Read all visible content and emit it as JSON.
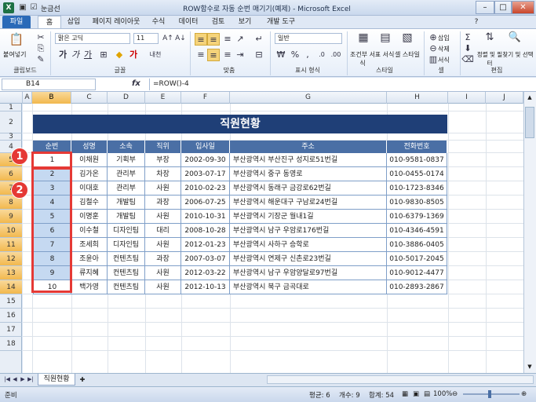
{
  "window": {
    "title": "ROW함수로 자동 순번 매기기(예제) - Microsoft Excel",
    "quick_access_label": "눈금선",
    "app_letter": "X",
    "controls": {
      "minimize": "–",
      "maximize": "□",
      "close": "✕"
    }
  },
  "tabs": [
    "파일",
    "홈",
    "삽입",
    "페이지 레이아웃",
    "수식",
    "데이터",
    "검토",
    "보기",
    "개발 도구"
  ],
  "ribbon": {
    "paste_label": "붙여넣기",
    "font_name": "맑은 고딕",
    "font_size": "11",
    "bold": "가",
    "italic": "가",
    "underline": "가",
    "number_format": "일반",
    "conditional": "조건부 서식",
    "table": "표 서식",
    "cell_style": "셀 스타일",
    "insert": "삽입",
    "delete": "삭제",
    "format": "서식",
    "sort_filter": "정렬 및 필터",
    "find_select": "찾기 및 선택",
    "groups": [
      "클립보드",
      "글꼴",
      "맞춤",
      "표시 형식",
      "스타일",
      "셀",
      "편집"
    ]
  },
  "formula_bar": {
    "name_box": "B14",
    "fx": "fx",
    "formula": "=ROW()-4"
  },
  "columns": [
    "A",
    "B",
    "C",
    "D",
    "E",
    "F",
    "G",
    "H",
    "I",
    "J"
  ],
  "selected_column": "B",
  "rows": [
    "1",
    "2",
    "3",
    "4",
    "5",
    "6",
    "7",
    "8",
    "9",
    "10",
    "11",
    "12",
    "13",
    "14",
    "15",
    "16",
    "17",
    "18"
  ],
  "selected_rows": [
    "5",
    "6",
    "7",
    "8",
    "9",
    "10",
    "11",
    "12",
    "13",
    "14"
  ],
  "table": {
    "title": "직원현황",
    "headers": [
      "순번",
      "성명",
      "소속",
      "직위",
      "입사일",
      "주소",
      "전화번호"
    ],
    "rows": [
      [
        "1",
        "이채원",
        "기획부",
        "부장",
        "2002-09-30",
        "부산광역시 부산진구 성지로51번길",
        "010-9581-0837"
      ],
      [
        "2",
        "김가온",
        "관리부",
        "차장",
        "2003-07-17",
        "부산광역시 중구 동영로",
        "010-0455-0174"
      ],
      [
        "3",
        "이대호",
        "관리부",
        "사원",
        "2010-02-23",
        "부산광역시 동래구 금강로62번길",
        "010-1723-8346"
      ],
      [
        "4",
        "김철수",
        "개발팀",
        "과장",
        "2006-07-25",
        "부산광역시 해운대구 구남로24번길",
        "010-9830-8505"
      ],
      [
        "5",
        "이명훈",
        "개발팀",
        "사원",
        "2010-10-31",
        "부산광역시 기장군 월내1길",
        "010-6379-1369"
      ],
      [
        "6",
        "이수철",
        "디자인팀",
        "대리",
        "2008-10-28",
        "부산광역시 남구 우암로176번길",
        "010-4346-4591"
      ],
      [
        "7",
        "조세희",
        "디자인팀",
        "사원",
        "2012-01-23",
        "부산광역시 사하구 승학로",
        "010-3886-0405"
      ],
      [
        "8",
        "조윤아",
        "컨텐츠팀",
        "과장",
        "2007-03-07",
        "부산광역시 연제구 신촌로23번길",
        "010-5017-2045"
      ],
      [
        "9",
        "류지혜",
        "컨텐츠팀",
        "사원",
        "2012-03-22",
        "부산광역시 남구 우암양달로97번길",
        "010-9012-4477"
      ],
      [
        "10",
        "백가영",
        "컨텐츠팀",
        "사원",
        "2012-10-13",
        "부산광역시 북구 금곡대로",
        "010-2893-2867"
      ]
    ]
  },
  "markers": [
    "1",
    "2"
  ],
  "sheet_tab": "직원현황",
  "status": {
    "ready": "준비",
    "average": "평균: 6",
    "count": "개수: 9",
    "sum": "합계: 54",
    "zoom": "100%"
  },
  "colors": {
    "accent_red": "#e53935",
    "header_blue": "#4a6fa5",
    "title_navy": "#1f3f77",
    "selection": "#c5d9f1"
  }
}
